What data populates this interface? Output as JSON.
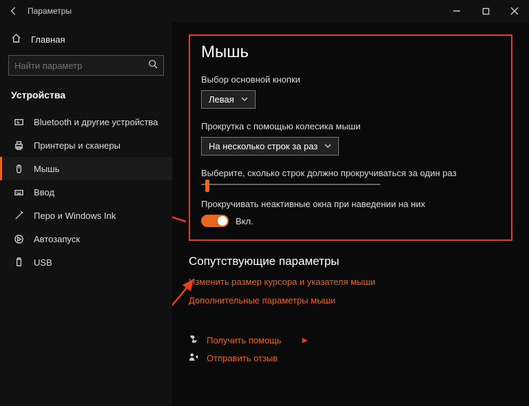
{
  "window": {
    "title": "Параметры"
  },
  "sidebar": {
    "home": "Главная",
    "search_placeholder": "Найти параметр",
    "category": "Устройства",
    "items": [
      {
        "label": "Bluetooth и другие устройства"
      },
      {
        "label": "Принтеры и сканеры"
      },
      {
        "label": "Мышь"
      },
      {
        "label": "Ввод"
      },
      {
        "label": "Перо и Windows Ink"
      },
      {
        "label": "Автозапуск"
      },
      {
        "label": "USB"
      }
    ]
  },
  "main": {
    "heading": "Мышь",
    "primary_button_label": "Выбор основной кнопки",
    "primary_button_value": "Левая",
    "scroll_wheel_label": "Прокрутка с помощью колесика мыши",
    "scroll_wheel_value": "На несколько строк за раз",
    "lines_label": "Выберите, сколько строк должно прокручиваться за один раз",
    "inactive_label": "Прокручивать неактивные окна при наведении на них",
    "toggle_state": "Вкл.",
    "related_head": "Сопутствующие параметры",
    "link_cursor": "Изменить размер курсора и указателя мыши",
    "link_additional": "Дополнительные параметры мыши",
    "link_help": "Получить помощь",
    "link_feedback": "Отправить отзыв"
  }
}
